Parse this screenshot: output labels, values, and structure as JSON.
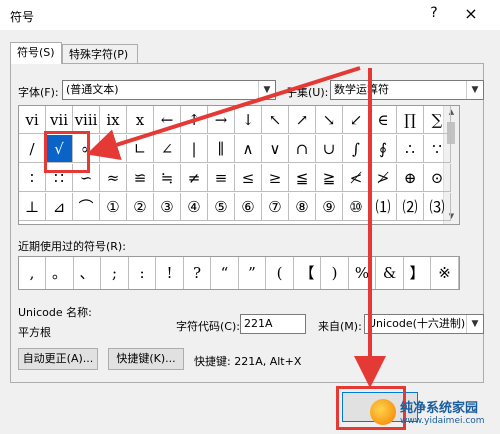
{
  "window": {
    "title": "符号",
    "help": "?",
    "close": "×"
  },
  "tabs": [
    {
      "label": "符号(S)"
    },
    {
      "label": "特殊字符(P)"
    }
  ],
  "font_label": "字体(F):",
  "font_value": "(普通文本)",
  "subset_label": "子集(U):",
  "subset_value": "数学运算符",
  "symbols": [
    [
      "vi",
      "vii",
      "viii",
      "ix",
      "x",
      "←",
      "↑",
      "→",
      "↓",
      "↖",
      "↗",
      "↘",
      "↙",
      "∈",
      "∏",
      "∑"
    ],
    [
      "/",
      "√",
      "∝",
      "∞",
      "∟",
      "∠",
      "|",
      "∥",
      "∧",
      "∨",
      "∩",
      "∪",
      "∫",
      "∮",
      "∴",
      "∵"
    ],
    [
      "∶",
      "∷",
      "∽",
      "≈",
      "≌",
      "≒",
      "≠",
      "≡",
      "≤",
      "≥",
      "≦",
      "≧",
      "≮",
      "≯",
      "⊕",
      "⊙"
    ],
    [
      "⊥",
      "⊿",
      "⌒",
      "①",
      "②",
      "③",
      "④",
      "⑤",
      "⑥",
      "⑦",
      "⑧",
      "⑨",
      "⑩",
      "⑴",
      "⑵",
      "⑶"
    ]
  ],
  "recent_label": "近期使用过的符号(R):",
  "recent": [
    ",",
    "。",
    "、",
    ";",
    ":",
    "!",
    "?",
    "“",
    "”",
    "(",
    "【",
    ")",
    "%",
    "&",
    "】",
    "※"
  ],
  "unicode_name_label": "Unicode 名称:",
  "unicode_name": "平方根",
  "char_code_label": "字符代码(C):",
  "char_code": "221A",
  "from_label": "来自(M):",
  "from_value": "Unicode(十六进制)",
  "autocorrect": "自动更正(A)...",
  "shortcut_btn": "快捷键(K)...",
  "shortcut_info": "快捷键: 221A, Alt+X",
  "watermark": {
    "title": "纯净系统家园",
    "url": "www.yidaimei.com"
  },
  "colors": {
    "highlight": "#e53935",
    "selected": "#0a64c8"
  }
}
